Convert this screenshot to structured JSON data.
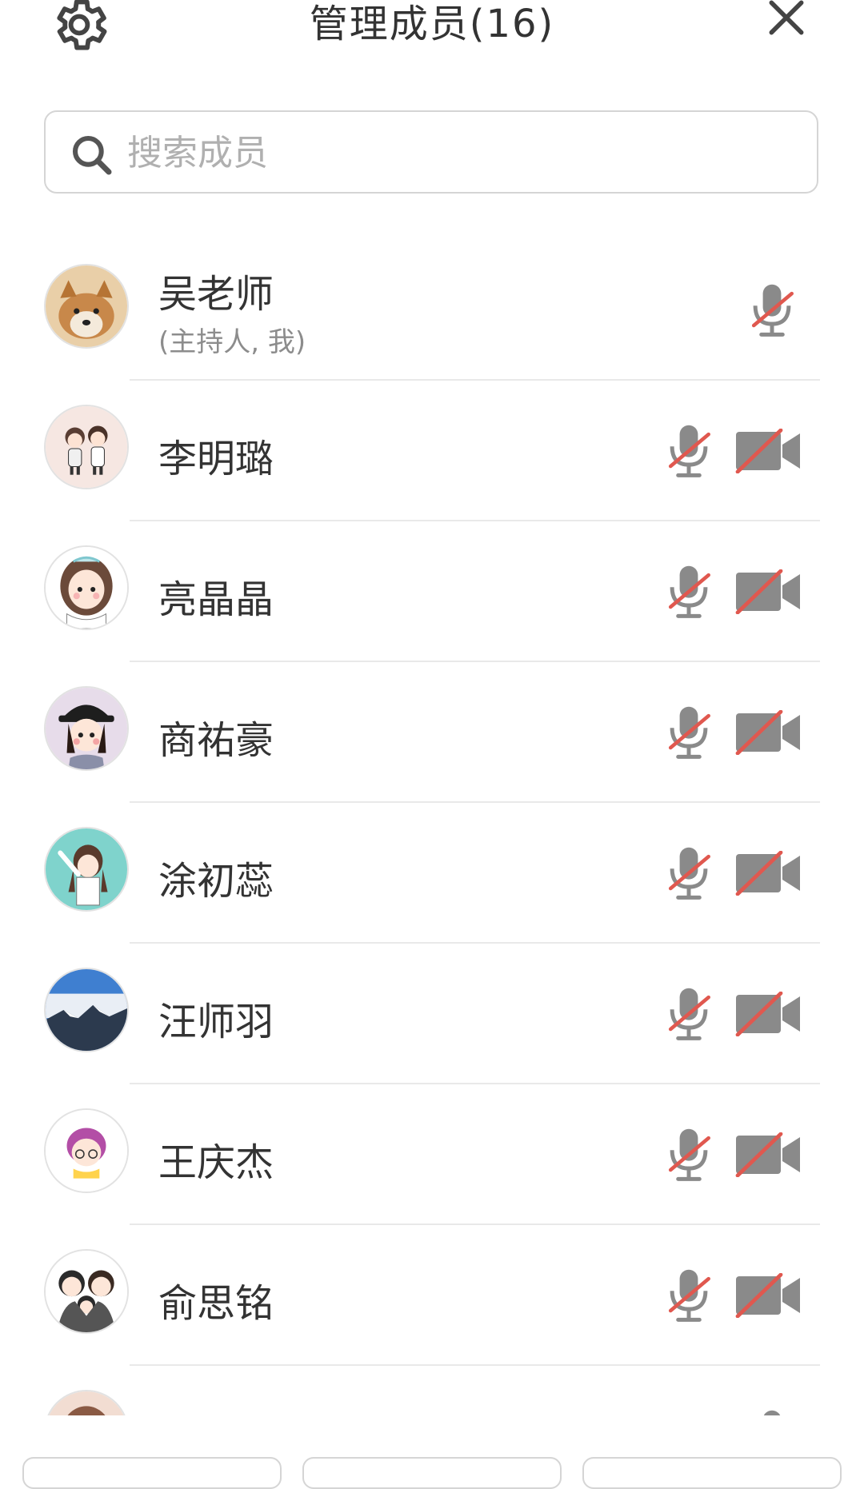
{
  "header": {
    "title": "管理成员(16)",
    "settings_icon": "gear-icon",
    "close_icon": "close-icon"
  },
  "search": {
    "placeholder": "搜索成员",
    "icon": "search-icon"
  },
  "members": [
    {
      "name": "吴老师",
      "role": "(主持人, 我)",
      "mic": "muted",
      "camera": "none"
    },
    {
      "name": "李明璐",
      "mic": "muted",
      "camera": "off"
    },
    {
      "name": "亮晶晶",
      "mic": "muted",
      "camera": "off"
    },
    {
      "name": "商祐豪",
      "mic": "muted",
      "camera": "off"
    },
    {
      "name": "涂初蕊",
      "mic": "muted",
      "camera": "off"
    },
    {
      "name": "汪师羽",
      "mic": "muted",
      "camera": "off"
    },
    {
      "name": "王庆杰",
      "mic": "muted",
      "camera": "off"
    },
    {
      "name": "俞思铭",
      "mic": "muted",
      "camera": "off"
    }
  ],
  "colors": {
    "icon_gray": "#8a8a8a",
    "strike_red": "#e0584f",
    "divider": "#e9e9e9"
  }
}
